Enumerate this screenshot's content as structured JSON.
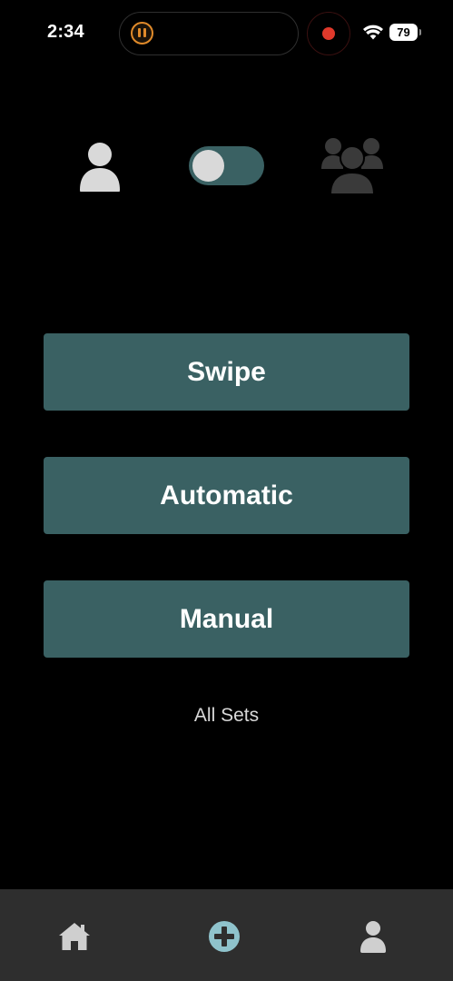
{
  "status_bar": {
    "time": "2:34",
    "battery_level": "79",
    "icons": [
      "pause-indicator-icon",
      "record-indicator-icon",
      "wifi-icon",
      "battery-icon"
    ],
    "colors": {
      "pause_indicator": "#e08a2a",
      "record_indicator": "#e0392b"
    }
  },
  "mode_toggle": {
    "left_icon": "single-user-icon",
    "right_icon": "group-icon",
    "switch_state": "off",
    "colors": {
      "track": "#3a6163",
      "knob": "#d9d9d9",
      "single_user_icon": "#d9d9d9",
      "group_icon": "#3a3a3a"
    }
  },
  "actions": {
    "swipe_label": "Swipe",
    "automatic_label": "Automatic",
    "manual_label": "Manual",
    "button_color": "#3a6163"
  },
  "all_sets_label": "All Sets",
  "tab_bar": {
    "items": [
      {
        "icon": "home-icon",
        "color": "#cfcfcf"
      },
      {
        "icon": "add-circle-icon",
        "color": "#8fc3cc"
      },
      {
        "icon": "profile-icon",
        "color": "#cfcfcf"
      }
    ],
    "background": "#2e2e2e"
  }
}
